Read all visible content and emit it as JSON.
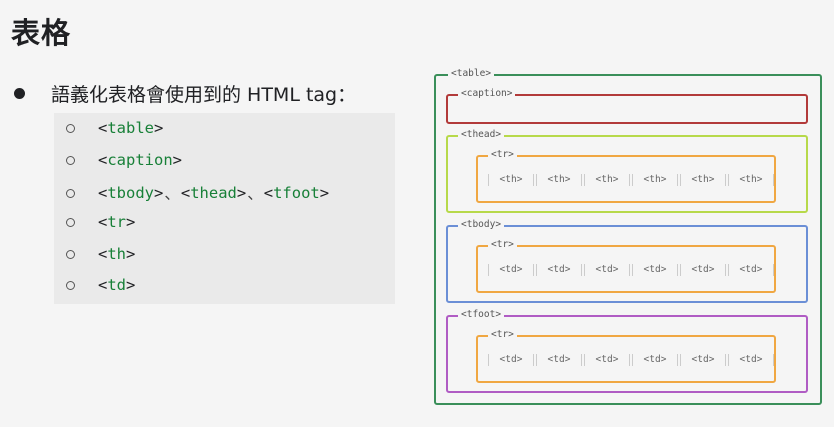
{
  "title": "表格",
  "bullet": {
    "text": "語義化表格會使用到的 HTML tag："
  },
  "list": {
    "table": "table",
    "caption": "caption",
    "tbody": "tbody",
    "thead": "thead",
    "tfoot": "tfoot",
    "sep": "、",
    "tr": "tr",
    "th": "th",
    "td": "td"
  },
  "diagram": {
    "table_label": "<table>",
    "caption_label": "<caption>",
    "thead_label": "<thead>",
    "tbody_label": "<tbody>",
    "tfoot_label": "<tfoot>",
    "tr_label": "<tr>",
    "th_cell": "<th>",
    "td_cell": "<td>"
  },
  "colors": {
    "table": "#3a8f5a",
    "caption": "#b23a3a",
    "thead": "#b7d94a",
    "tbody": "#6b8fd6",
    "tfoot": "#b05cc4",
    "tr": "#f0a742"
  }
}
